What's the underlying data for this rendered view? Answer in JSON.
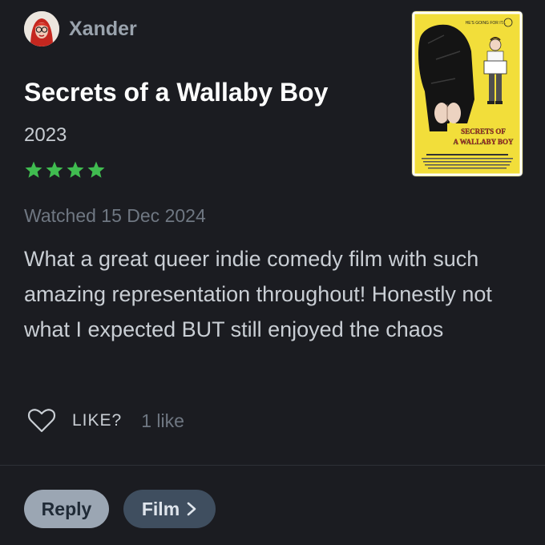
{
  "reviewer": {
    "name": "Xander",
    "avatar_icon": "avatar"
  },
  "film": {
    "title": "Secrets of a Wallaby Boy",
    "year": "2023",
    "rating_stars": 4,
    "star_color": "#40bc50",
    "poster": {
      "tagline": "HE'S GOING FOR IT...",
      "title_line1": "SECRETS OF",
      "title_line2": "A WALLABY BOY",
      "background_color": "#f2de3a"
    }
  },
  "review": {
    "watched": "Watched 15 Dec 2024",
    "text": "What a great queer indie comedy film with such amazing representation throughout! Honestly not what I expected BUT still enjoyed the chaos"
  },
  "actions": {
    "like_label": "LIKE?",
    "like_count": "1 like",
    "reply_label": "Reply",
    "film_label": "Film"
  },
  "colors": {
    "background": "#1b1c21",
    "accent_green": "#40bc50",
    "reply_bg": "#9ba6b3",
    "film_bg": "#3f4e5f"
  }
}
